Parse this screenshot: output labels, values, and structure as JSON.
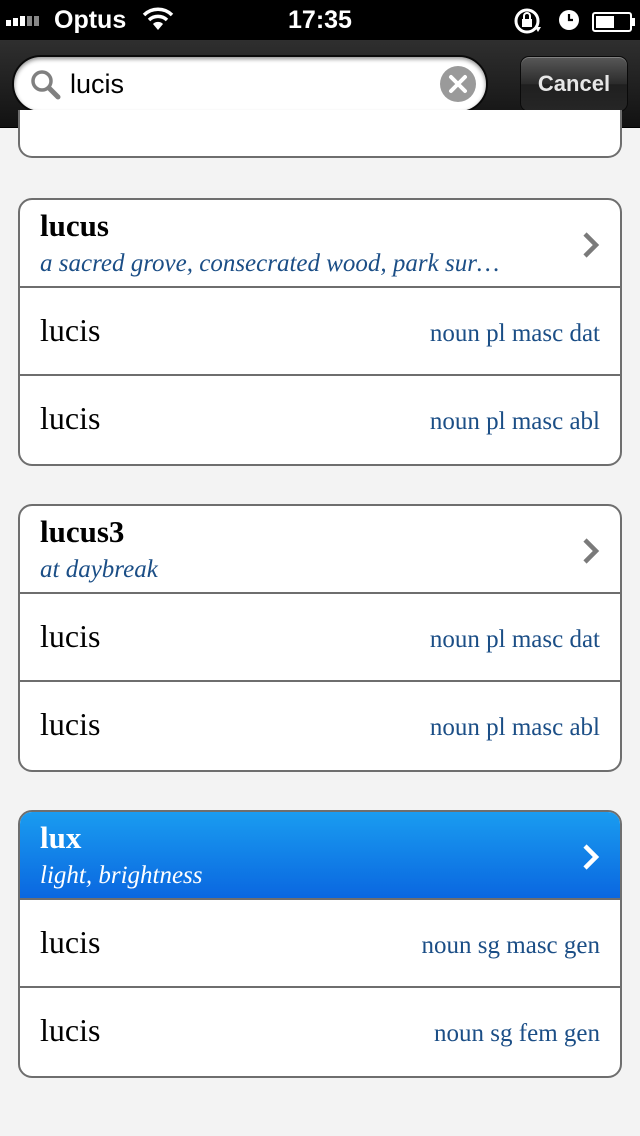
{
  "status_bar": {
    "carrier": "Optus",
    "time": "17:35"
  },
  "search": {
    "query": "lucis",
    "cancel_label": "Cancel"
  },
  "colors": {
    "gloss": "#1b4e86",
    "selected_header": "#0a67e0",
    "card_border": "#6e6e6e"
  },
  "entries": [
    {
      "headword": "lucus",
      "gloss": "a sacred grove, consecrated wood, park sur…",
      "forms": [
        {
          "word": "lucis",
          "parse": "noun pl masc dat"
        },
        {
          "word": "lucis",
          "parse": "noun pl masc abl"
        }
      ]
    },
    {
      "headword": "lucus3",
      "gloss": "at daybreak",
      "forms": [
        {
          "word": "lucis",
          "parse": "noun pl masc dat"
        },
        {
          "word": "lucis",
          "parse": "noun pl masc abl"
        }
      ]
    },
    {
      "headword": "lux",
      "gloss": "light, brightness",
      "selected": true,
      "forms": [
        {
          "word": "lucis",
          "parse": "noun sg masc gen"
        },
        {
          "word": "lucis",
          "parse": "noun sg fem gen"
        }
      ]
    }
  ]
}
